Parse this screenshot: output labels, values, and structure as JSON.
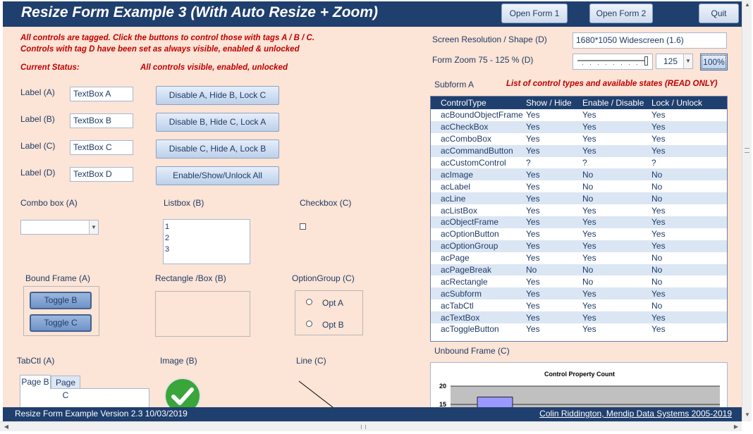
{
  "window": {
    "title": "Resize Form Example 3 (With Auto Resize + Zoom)",
    "buttons": [
      "Open Form 1",
      "Open Form 2",
      "Quit"
    ]
  },
  "info": {
    "line1": "All controls are tagged. Click the buttons to control those with tags A / B / C.",
    "line2": "Controls with tag D have been set as always visible, enabled & unlocked",
    "status_label": "Current Status:",
    "status_value": "All controls visible, enabled, unlocked"
  },
  "labels": [
    "Label (A)",
    "Label (B)",
    "Label (C)",
    "Label (D)"
  ],
  "textboxes": [
    "TextBox A",
    "TextBox B",
    "TextBox C",
    "TextBox D"
  ],
  "commands": [
    "Disable A, Hide B, Lock C",
    "Disable B, Hide C, Lock A",
    "Disable C, Hide A, Lock B",
    "Enable/Show/Unlock All"
  ],
  "combo": {
    "label": "Combo box (A)",
    "value": ""
  },
  "listbox": {
    "label": "Listbox  (B)",
    "items": [
      "1",
      "2",
      "3"
    ]
  },
  "checkbox": {
    "label": "Checkbox (C)",
    "checked": false
  },
  "bound_frame": {
    "label": "Bound Frame (A)",
    "toggles": [
      "Toggle B",
      "Toggle C"
    ]
  },
  "rectangle": {
    "label": "Rectangle /Box (B)"
  },
  "option_group": {
    "label": "OptionGroup (C)",
    "options": [
      "Opt A",
      "Opt B"
    ]
  },
  "tabctl": {
    "label": "TabCtl (A)",
    "tabs": [
      "Page B",
      "Page C"
    ]
  },
  "image": {
    "label": "Image (B)",
    "icon": "green-checkmark-icon"
  },
  "line": {
    "label": "Line (C)"
  },
  "screen": {
    "label": "Screen Resolution / Shape (D)",
    "value": "1680*1050 Widescreen (1.6)"
  },
  "zoom": {
    "label": "Form Zoom  75 - 125 %    (D)",
    "value": "125",
    "button": "100%"
  },
  "subform": {
    "label": "Subform A",
    "caption": "List of control types and available states  (READ ONLY)",
    "columns": [
      "ControlType",
      "Show / Hide",
      "Enable / Disable",
      "Lock / Unlock"
    ],
    "rows": [
      [
        "acBoundObjectFrame",
        "Yes",
        "Yes",
        "Yes"
      ],
      [
        "acCheckBox",
        "Yes",
        "Yes",
        "Yes"
      ],
      [
        "acComboBox",
        "Yes",
        "Yes",
        "Yes"
      ],
      [
        "acCommandButton",
        "Yes",
        "Yes",
        "Yes"
      ],
      [
        "acCustomControl",
        "?",
        "?",
        "?"
      ],
      [
        "acImage",
        "Yes",
        "No",
        "No"
      ],
      [
        "acLabel",
        "Yes",
        "No",
        "No"
      ],
      [
        "acLine",
        "Yes",
        "No",
        "No"
      ],
      [
        "acListBox",
        "Yes",
        "Yes",
        "Yes"
      ],
      [
        "acObjectFrame",
        "Yes",
        "Yes",
        "Yes"
      ],
      [
        "acOptionButton",
        "Yes",
        "Yes",
        "Yes"
      ],
      [
        "acOptionGroup",
        "Yes",
        "Yes",
        "Yes"
      ],
      [
        "acPage",
        "Yes",
        "Yes",
        "No"
      ],
      [
        "acPageBreak",
        "No",
        "No",
        "No"
      ],
      [
        "acRectangle",
        "Yes",
        "No",
        "No"
      ],
      [
        "acSubform",
        "Yes",
        "Yes",
        "Yes"
      ],
      [
        "acTabCtl",
        "Yes",
        "Yes",
        "No"
      ],
      [
        "acTextBox",
        "Yes",
        "Yes",
        "Yes"
      ],
      [
        "acToggleButton",
        "Yes",
        "Yes",
        "Yes"
      ]
    ]
  },
  "unbound_frame": {
    "label": "Unbound Frame (C)"
  },
  "chart_data": {
    "type": "bar",
    "title": "Control Property Count",
    "yticks": [
      20,
      15
    ],
    "visible_bar_value": 17,
    "colors": {
      "bar": "#9999ff",
      "plot_bg": "#c0c0c0"
    }
  },
  "statusbar": {
    "left": "Resize Form Example   Version 2.3  10/03/2019",
    "right": "Colin Riddington, Mendip Data Systems 2005-2019"
  },
  "colors": {
    "header": "#1f3f6e",
    "body": "#fce4d6",
    "red": "#c00000",
    "text": "#1f3b66",
    "alt_row": "#dbe6f4"
  }
}
